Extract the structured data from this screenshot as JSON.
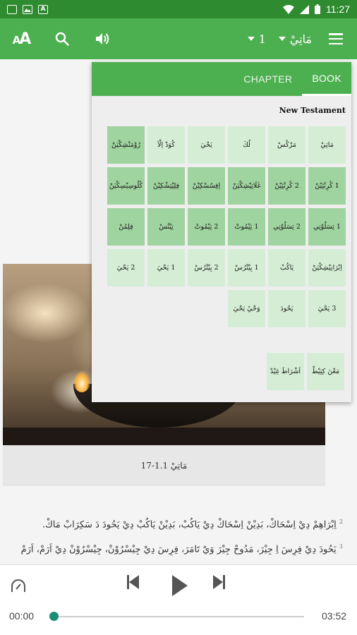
{
  "status_bar": {
    "time": "11:27",
    "left_icons": [
      "gallery-notification-icon",
      "image-notification-icon",
      "app-notification-icon"
    ],
    "right_icons": [
      "wifi-icon",
      "signal-icon",
      "battery-icon"
    ]
  },
  "app_bar": {
    "book": "مَاتِيْ",
    "chapter": "1",
    "icons": [
      "text-size-icon",
      "search-icon",
      "audio-icon",
      "menu-icon"
    ]
  },
  "book_panel": {
    "tabs": [
      "CHAPTER",
      "BOOK"
    ],
    "active_tab": "BOOK",
    "section": "New Testament",
    "books": [
      "مَاتِيْ",
      "مَرْكُسْ",
      "لُكَ",
      "يَحْيَ",
      "كُوَدْ اِلْاَ",
      "رُوْمَنْشِكْيَنْ",
      "1 كُرِنْثِيْنْ",
      "2 كُرِنْثِيْنْ",
      "غَلَاتِيْشِكْيَنْ",
      "اِفِسُسْكِيْنْ",
      "فِلِيْتِشْكِيْنْ",
      "كُلُوسِيْسِكْيَنْ",
      "1 تِسَلُوْنِي",
      "2 تِسَلُوْنِي",
      "1 تِيْمُوتْ",
      "2 تِيْمُوتْ",
      "تِيْتُسْ",
      "فِلِمُنْ",
      "اِبْرَانِيْشِكْيَنْ",
      "يَاكُبْ",
      "1 بِيْتْرُسْ",
      "2 بِيْتْرُسْ",
      "1 يَحْيَ",
      "2 يَحْيَ",
      "3 يَحْيَ",
      "يَحُودَ",
      "وَحْيُ يَحْيَ"
    ],
    "extras": [
      "مَعْنَ كِتِيْطْ",
      "اَشْرَاطَ غِيْدْ"
    ]
  },
  "content": {
    "caption": "مَاتِيْ 1.1-17",
    "verses": [
      {
        "num": "2",
        "text": "اِبْرَاهِمْ دِيْ اِسْحَاكْ، بَدِيْنْ اِسْحَاكْ دِيْ يَاكُبْ، بَدِيْنْ يَاكُبْ دِيْ يَحُودَ دَ سَكِرَابْ مَاكْ."
      },
      {
        "num": "3",
        "text": "يَحُودَ دِيْ فِرِسَ اِ جِيْرَ، مَدُوحْ جِيْرَ وَيْ تَامَرَ، فِرِسَ دِيْ جِيْسْرُوْنْ، جِيْسْرُوْنْ دِيْ اَرَمْ، اَرَمْ دِيْ"
      }
    ]
  },
  "player": {
    "elapsed": "00:00",
    "duration": "03:52",
    "progress": 0.0
  }
}
